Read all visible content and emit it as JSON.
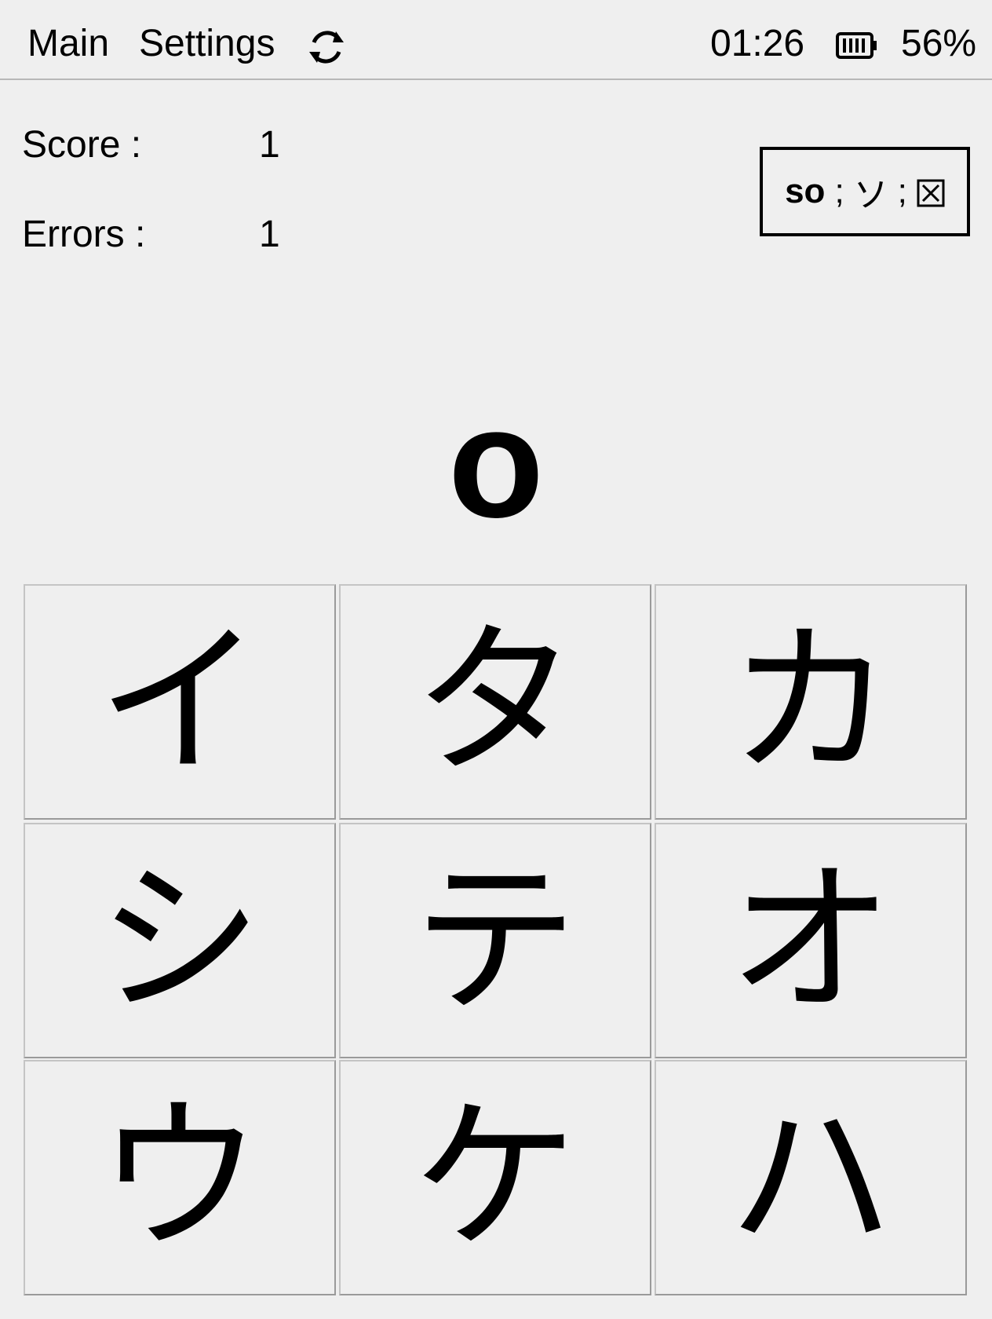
{
  "topbar": {
    "main_label": "Main",
    "settings_label": "Settings",
    "refresh_icon": "refresh-icon",
    "clock": "01:26",
    "battery_icon": "battery-icon",
    "battery_percent": "56%"
  },
  "stats": {
    "score_label": "Score :",
    "score_value": "1",
    "errors_label": "Errors :",
    "errors_value": "1"
  },
  "last_answer": {
    "romaji": "so",
    "separator": ";",
    "kana": "ソ",
    "result_icon": "wrong-box-icon"
  },
  "prompt": "o",
  "choices": [
    "イ",
    "タ",
    "カ",
    "シ",
    "テ",
    "オ",
    "ウ",
    "ケ",
    "ハ"
  ]
}
